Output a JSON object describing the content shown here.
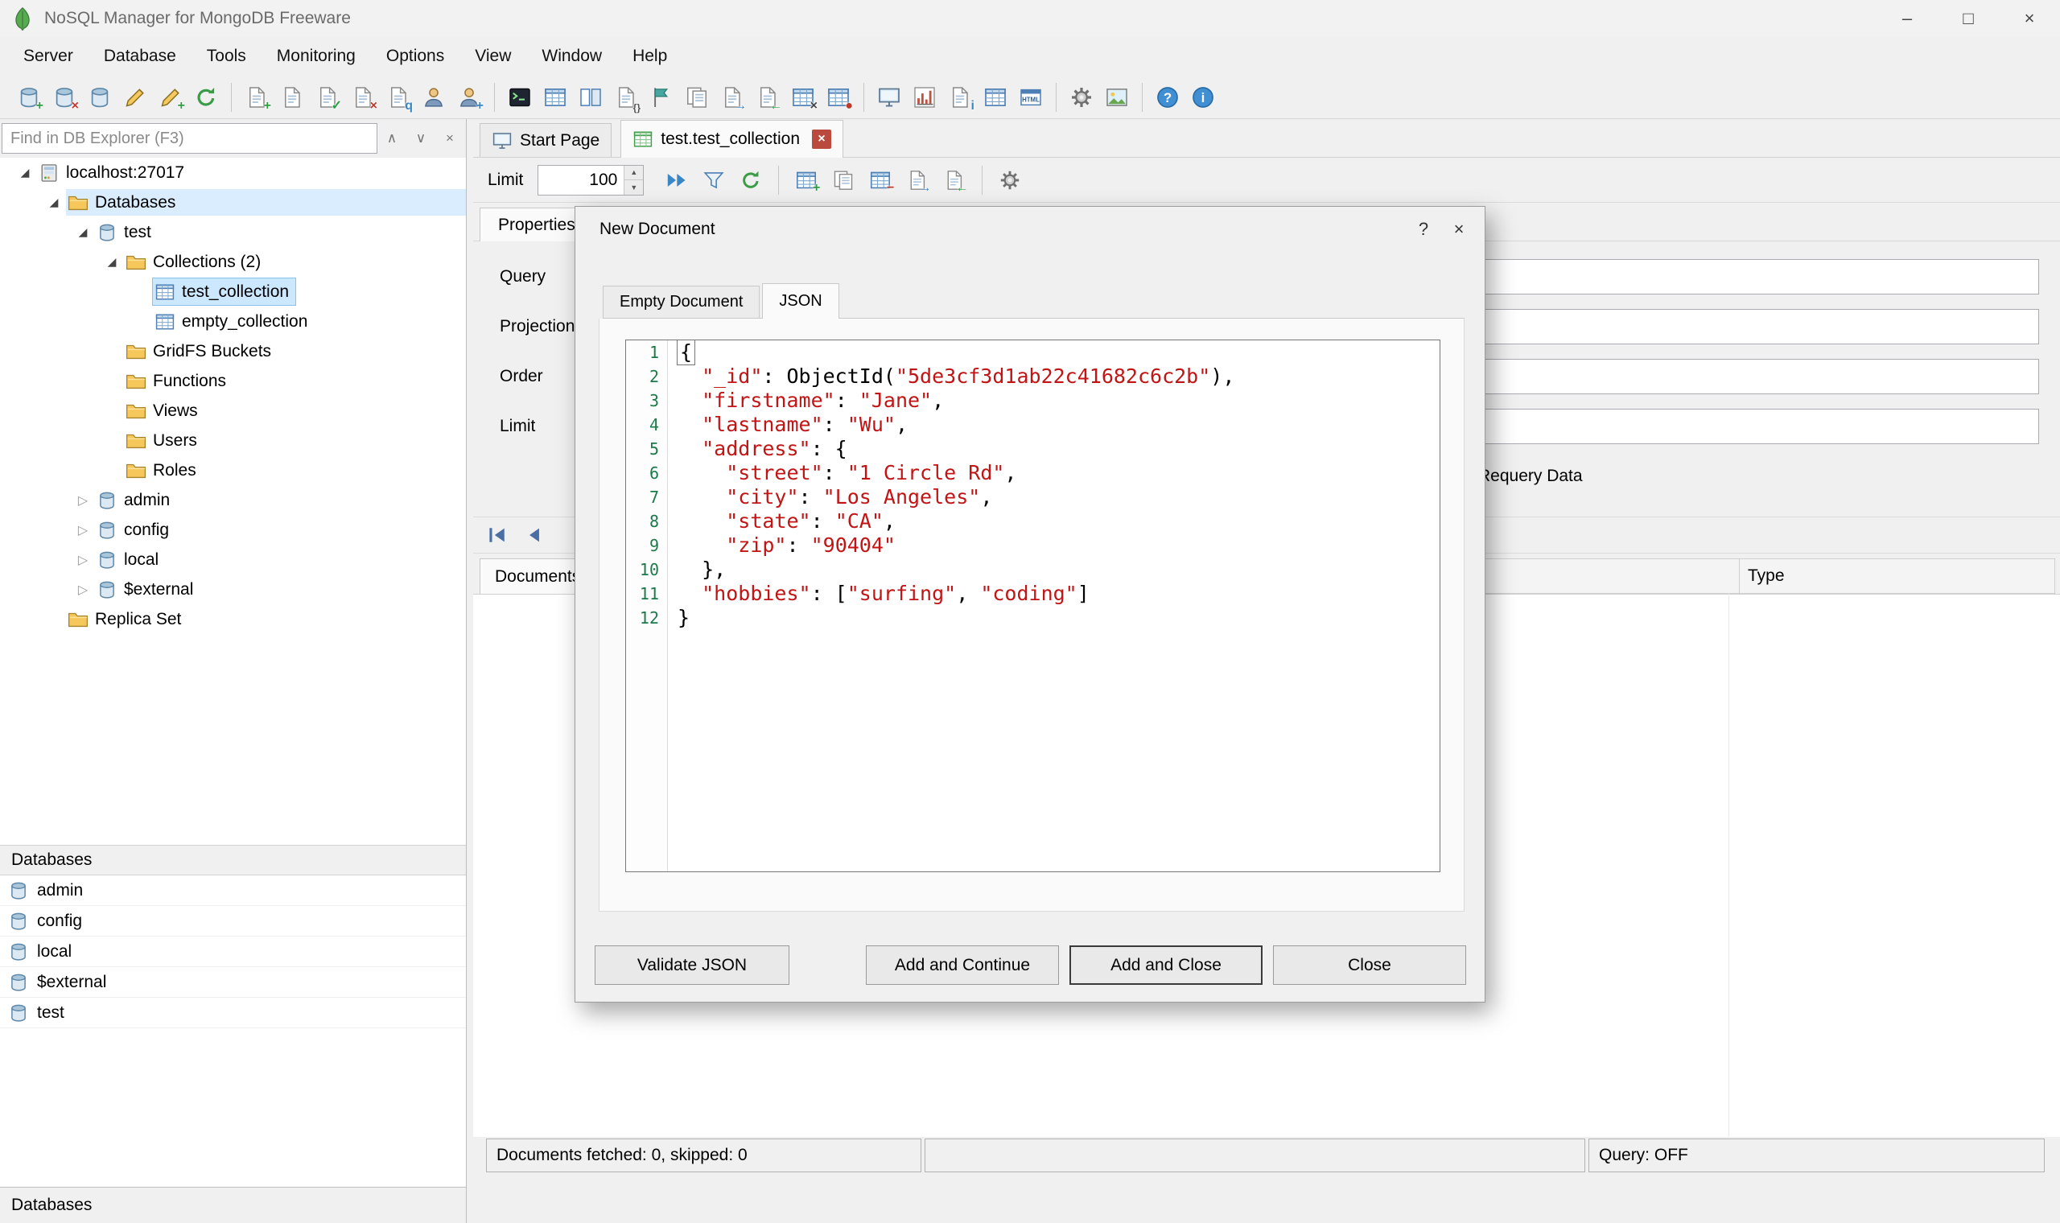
{
  "colors": {
    "code-string": "#c21414",
    "line-number": "#1b7a4a",
    "sel-bg": "#cce8ff",
    "sel-border": "#86c4ee",
    "row-hl": "#d9edff",
    "tab-close": "#b94a3d"
  },
  "window": {
    "title": "NoSQL Manager for MongoDB Freeware",
    "controls": {
      "minimize": "–",
      "maximize": "□",
      "close": "×"
    }
  },
  "menu": {
    "items": [
      "Server",
      "Database",
      "Tools",
      "Monitoring",
      "Options",
      "View",
      "Window",
      "Help"
    ]
  },
  "toolbar": {
    "icons": [
      {
        "name": "connect-server",
        "shape": "cylinder",
        "badge": "+",
        "badge_color": "#2e9e44"
      },
      {
        "name": "disconnect-server",
        "shape": "cylinder",
        "badge": "×",
        "badge_color": "#c0392b"
      },
      {
        "name": "server-registration",
        "shape": "cylinder"
      },
      {
        "name": "edit-connection",
        "shape": "pencil"
      },
      {
        "name": "new-connection",
        "shape": "pencil",
        "badge": "+",
        "badge_color": "#2e9e44"
      },
      {
        "name": "refresh-explorer",
        "shape": "refresh"
      },
      {
        "sep": true
      },
      {
        "name": "new-document",
        "shape": "page",
        "badge": "+",
        "badge_color": "#2e9e44"
      },
      {
        "name": "open-document",
        "shape": "page"
      },
      {
        "name": "save-document",
        "shape": "page",
        "badge": "✓",
        "badge_color": "#2e9e44"
      },
      {
        "name": "delete-document",
        "shape": "page",
        "badge": "×",
        "badge_color": "#c0392b"
      },
      {
        "name": "linq-query",
        "shape": "page",
        "badge": "q",
        "badge_color": "#3b86c4"
      },
      {
        "name": "users",
        "shape": "user"
      },
      {
        "name": "roles",
        "shape": "user",
        "badge": "+",
        "badge_color": "#3b86c4"
      },
      {
        "sep": true
      },
      {
        "name": "mongo-shell",
        "shape": "terminal"
      },
      {
        "name": "data-grid",
        "shape": "table"
      },
      {
        "name": "split-view",
        "shape": "split"
      },
      {
        "name": "script-editor",
        "shape": "page",
        "badge": "{}",
        "badge_color": "#555555"
      },
      {
        "name": "bookmarks",
        "shape": "flag"
      },
      {
        "name": "copy-collection",
        "shape": "pages"
      },
      {
        "name": "export-data",
        "shape": "page",
        "badge": "→",
        "badge_color": "#3b86c4"
      },
      {
        "name": "import-data",
        "shape": "page",
        "badge": "←",
        "badge_color": "#2e9e44"
      },
      {
        "name": "map-reduce",
        "shape": "table",
        "badge": "×",
        "badge_color": "#444444"
      },
      {
        "name": "aggregation",
        "shape": "table",
        "badge": "●",
        "badge_color": "#c0392b"
      },
      {
        "sep": true
      },
      {
        "name": "monitoring",
        "shape": "monitor"
      },
      {
        "name": "profiler",
        "shape": "chart"
      },
      {
        "name": "server-status",
        "shape": "page",
        "badge": "i",
        "badge_color": "#3b86c4"
      },
      {
        "name": "table-report",
        "shape": "table"
      },
      {
        "name": "html-report",
        "shape": "html"
      },
      {
        "sep": true
      },
      {
        "name": "options",
        "shape": "gear"
      },
      {
        "name": "image-tools",
        "shape": "image"
      },
      {
        "sep": true
      },
      {
        "name": "help",
        "shape": "circle",
        "letter": "?"
      },
      {
        "name": "about",
        "shape": "circle",
        "letter": "i"
      }
    ]
  },
  "explorer": {
    "search_placeholder": "Find in DB Explorer (F3)",
    "search_buttons": [
      {
        "name": "search-previous",
        "glyph": "∧"
      },
      {
        "name": "search-next",
        "glyph": "∨"
      },
      {
        "name": "search-close",
        "glyph": "×"
      }
    ],
    "tree": [
      {
        "depth": 0,
        "icon": "server",
        "label": "localhost:27017",
        "expander": "expanded"
      },
      {
        "depth": 1,
        "icon": "folder",
        "label": "Databases",
        "expander": "expanded",
        "highlight": true
      },
      {
        "depth": 2,
        "icon": "database",
        "label": "test",
        "expander": "expanded"
      },
      {
        "depth": 3,
        "icon": "folder",
        "label": "Collections (2)",
        "expander": "expanded"
      },
      {
        "depth": 4,
        "icon": "collection",
        "label": "test_collection",
        "selected": true
      },
      {
        "depth": 4,
        "icon": "collection",
        "label": "empty_collection"
      },
      {
        "depth": 3,
        "icon": "folder",
        "label": "GridFS Buckets"
      },
      {
        "depth": 3,
        "icon": "folder",
        "label": "Functions"
      },
      {
        "depth": 3,
        "icon": "folder",
        "label": "Views"
      },
      {
        "depth": 3,
        "icon": "folder",
        "label": "Users"
      },
      {
        "depth": 3,
        "icon": "folder",
        "label": "Roles"
      },
      {
        "depth": 2,
        "icon": "database",
        "label": "admin",
        "expander": "collapsed"
      },
      {
        "depth": 2,
        "icon": "database",
        "label": "config",
        "expander": "collapsed"
      },
      {
        "depth": 2,
        "icon": "database",
        "label": "local",
        "expander": "collapsed"
      },
      {
        "depth": 2,
        "icon": "database",
        "label": "$external",
        "expander": "collapsed"
      },
      {
        "depth": 1,
        "icon": "folder",
        "label": "Replica Set"
      }
    ],
    "databases_header": "Databases",
    "databases": [
      "admin",
      "config",
      "local",
      "$external",
      "test"
    ],
    "status_text": "Databases"
  },
  "main": {
    "tabs": [
      {
        "label": "Start Page",
        "icon": "monitor"
      },
      {
        "label": "test.test_collection",
        "icon": "tableg",
        "active": true,
        "close_glyph": "×"
      }
    ],
    "query_toolbar": {
      "limit_label": "Limit",
      "limit_value": "100",
      "spinner_up": "▲",
      "spinner_down": "▼",
      "icons": [
        {
          "name": "execute-query",
          "shape": "play2"
        },
        {
          "name": "filter-builder",
          "shape": "funnel"
        },
        {
          "name": "requery",
          "shape": "refresh"
        },
        {
          "sep": true
        },
        {
          "name": "insert-document",
          "shape": "table",
          "badge": "+",
          "badge_color": "#2e9e44"
        },
        {
          "name": "duplicate-document",
          "shape": "pages"
        },
        {
          "name": "delete-document",
          "shape": "table",
          "badge": "−",
          "badge_color": "#c0392b"
        },
        {
          "name": "export-documents",
          "shape": "page",
          "badge": "→",
          "badge_color": "#3b86c4"
        },
        {
          "name": "import-documents",
          "shape": "page",
          "badge": "←",
          "badge_color": "#2e9e44"
        },
        {
          "sep": true
        },
        {
          "name": "grid-options",
          "shape": "gear"
        }
      ]
    },
    "properties": {
      "tab_label": "Properties",
      "rows": [
        {
          "label": "Query"
        },
        {
          "label": "Projection"
        },
        {
          "label": "Order"
        },
        {
          "label": "Limit"
        }
      ],
      "requery_label": "Requery Data"
    },
    "navigator": [
      {
        "name": "first-record",
        "shape": "navfirst"
      },
      {
        "name": "previous-record",
        "shape": "navprev"
      }
    ],
    "documents": {
      "tab_label": "Documents",
      "type_column": "Type"
    },
    "status": {
      "left": "Documents fetched: 0, skipped: 0",
      "right": "Query: OFF"
    }
  },
  "dialog": {
    "title": "New Document",
    "help_glyph": "?",
    "close_glyph": "×",
    "tabs": [
      {
        "label": "Empty Document"
      },
      {
        "label": "JSON",
        "active": true
      }
    ],
    "editor": {
      "lines": [
        {
          "n": 1,
          "current": true,
          "t": [
            [
              "p",
              "{"
            ]
          ]
        },
        {
          "n": 2,
          "t": [
            [
              "p",
              "  "
            ],
            [
              "s",
              "\"_id\""
            ],
            [
              "p",
              ": ObjectId("
            ],
            [
              "s",
              "\"5de3cf3d1ab22c41682c6c2b\""
            ],
            [
              "p",
              "),"
            ]
          ]
        },
        {
          "n": 3,
          "t": [
            [
              "p",
              "  "
            ],
            [
              "s",
              "\"firstname\""
            ],
            [
              "p",
              ": "
            ],
            [
              "s",
              "\"Jane\""
            ],
            [
              "p",
              ","
            ]
          ]
        },
        {
          "n": 4,
          "t": [
            [
              "p",
              "  "
            ],
            [
              "s",
              "\"lastname\""
            ],
            [
              "p",
              ": "
            ],
            [
              "s",
              "\"Wu\""
            ],
            [
              "p",
              ","
            ]
          ]
        },
        {
          "n": 5,
          "t": [
            [
              "p",
              "  "
            ],
            [
              "s",
              "\"address\""
            ],
            [
              "p",
              ": {"
            ]
          ]
        },
        {
          "n": 6,
          "t": [
            [
              "p",
              "    "
            ],
            [
              "s",
              "\"street\""
            ],
            [
              "p",
              ": "
            ],
            [
              "s",
              "\"1 Circle Rd\""
            ],
            [
              "p",
              ","
            ]
          ]
        },
        {
          "n": 7,
          "t": [
            [
              "p",
              "    "
            ],
            [
              "s",
              "\"city\""
            ],
            [
              "p",
              ": "
            ],
            [
              "s",
              "\"Los Angeles\""
            ],
            [
              "p",
              ","
            ]
          ]
        },
        {
          "n": 8,
          "t": [
            [
              "p",
              "    "
            ],
            [
              "s",
              "\"state\""
            ],
            [
              "p",
              ": "
            ],
            [
              "s",
              "\"CA\""
            ],
            [
              "p",
              ","
            ]
          ]
        },
        {
          "n": 9,
          "t": [
            [
              "p",
              "    "
            ],
            [
              "s",
              "\"zip\""
            ],
            [
              "p",
              ": "
            ],
            [
              "s",
              "\"90404\""
            ]
          ]
        },
        {
          "n": 10,
          "t": [
            [
              "p",
              "  },"
            ]
          ]
        },
        {
          "n": 11,
          "t": [
            [
              "p",
              "  "
            ],
            [
              "s",
              "\"hobbies\""
            ],
            [
              "p",
              ": ["
            ],
            [
              "s",
              "\"surfing\""
            ],
            [
              "p",
              ", "
            ],
            [
              "s",
              "\"coding\""
            ],
            [
              "p",
              "]"
            ]
          ]
        },
        {
          "n": 12,
          "t": [
            [
              "p",
              "}"
            ]
          ]
        }
      ]
    },
    "buttons": [
      {
        "label": "Validate JSON"
      },
      {
        "label": "Add and Continue"
      },
      {
        "label": "Add and Close",
        "default": true
      },
      {
        "label": "Close"
      }
    ]
  }
}
